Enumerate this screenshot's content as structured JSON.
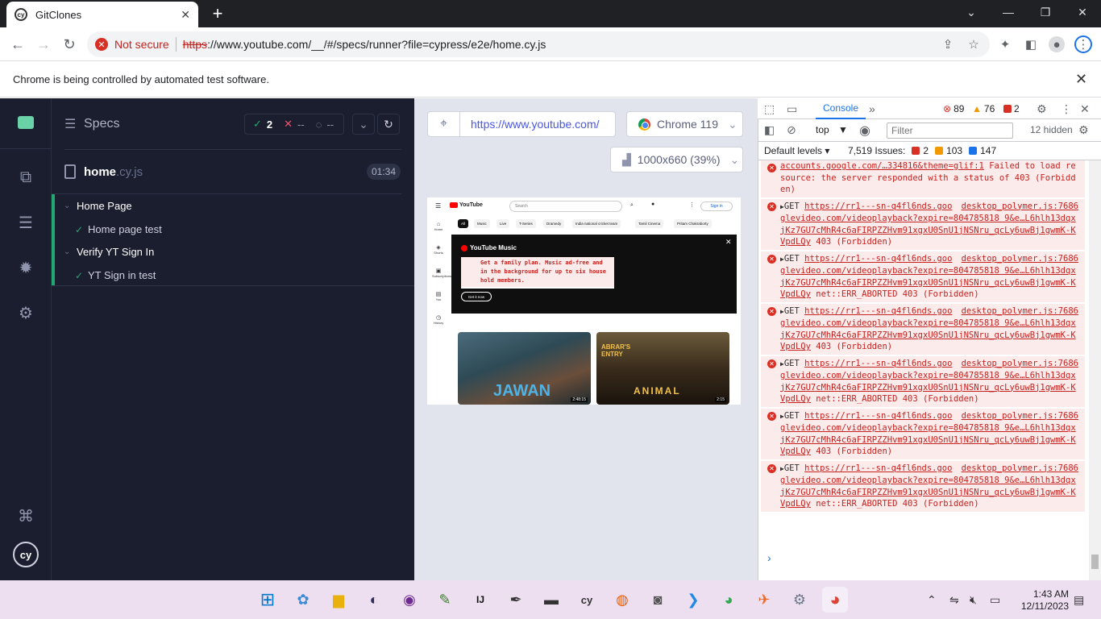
{
  "browser": {
    "tab_title": "GitClones",
    "not_secure_label": "Not secure",
    "url_scheme": "https",
    "url_rest": "://www.youtube.com/__/#/specs/runner?file=cypress/e2e/home.cy.js",
    "infobar_text": "Chrome is being controlled by automated test software."
  },
  "cypress": {
    "specs_title": "Specs",
    "passed_count": "2",
    "failed_count": "--",
    "pending_count": "--",
    "file_name": "home",
    "file_ext": ".cy.js",
    "duration": "01:34",
    "suites": [
      {
        "title": "Home Page",
        "tests": [
          "Home page test"
        ]
      },
      {
        "title": "Verify YT Sign In",
        "tests": [
          "YT Sign in test"
        ]
      }
    ],
    "aut_url": "https://www.youtube.com/",
    "browser_label": "Chrome 119",
    "viewport_label": "1000x660 (39%)"
  },
  "youtube_preview": {
    "logo": "YouTube",
    "search_placeholder": "Search",
    "sign_in": "Sign in",
    "chips": [
      "All",
      "Music",
      "Live",
      "T-Series",
      "Dramedy",
      "India national cricket team",
      "Tamil Cinema",
      "Pritam Chakraborty"
    ],
    "side_items": [
      "Home",
      "Shorts",
      "Subscriptions",
      "You",
      "History"
    ],
    "banner_brand": "YouTube Music",
    "banner_text": "Get a family plan. Music ad-free and in the background for up to six household members.",
    "banner_button": "Get it now",
    "thumb1_title": "JAWAN",
    "thumb1_duration": "2:48:15",
    "thumb2_title": "ANIMAL",
    "thumb2_top": "ABRAR'S ENTRY",
    "thumb2_duration": "2:15"
  },
  "devtools": {
    "tab_console": "Console",
    "errors": "89",
    "warnings": "76",
    "issues_badge": "2",
    "context": "top",
    "filter_placeholder": "Filter",
    "hidden_label": "12 hidden",
    "levels_label": "Default levels",
    "issues_label": "7,519 Issues:",
    "issues_red": "2",
    "issues_orange": "103",
    "issues_blue": "147",
    "messages": [
      {
        "method": "",
        "link": "accounts.google.com/…334816&theme=glif:1",
        "src": "",
        "tail": "Failed to load resource: the server responded with a status of 403 (Forbidden)"
      },
      {
        "method": "GET",
        "link": "https://rr1---sn-q4fl6nds.googlevideo.com/videoplayback?expire=804785818 9&e…L6hlh13dqxjKz7GU7cMhR4c6aFIRPZZHvm91xgxU0SnU1jNSNru_qcLy6uwBj1gwmK-KVpdLQy",
        "src": "desktop_polymer.js:7686",
        "tail": "403 (Forbidden)"
      },
      {
        "method": "GET",
        "link": "https://rr1---sn-q4fl6nds.googlevideo.com/videoplayback?expire=804785818 9&e…L6hlh13dqxjKz7GU7cMhR4c6aFIRPZZHvm91xgxU0SnU1jNSNru_qcLy6uwBj1gwmK-KVpdLQy",
        "src": "desktop_polymer.js:7686",
        "tail": "net::ERR_ABORTED 403 (Forbidden)"
      },
      {
        "method": "GET",
        "link": "https://rr1---sn-q4fl6nds.googlevideo.com/videoplayback?expire=804785818 9&e…L6hlh13dqxjKz7GU7cMhR4c6aFIRPZZHvm91xgxU0SnU1jNSNru_qcLy6uwBj1gwmK-KVpdLQy",
        "src": "desktop_polymer.js:7686",
        "tail": "403 (Forbidden)"
      },
      {
        "method": "GET",
        "link": "https://rr1---sn-q4fl6nds.googlevideo.com/videoplayback?expire=804785818 9&e…L6hlh13dqxjKz7GU7cMhR4c6aFIRPZZHvm91xgxU0SnU1jNSNru_qcLy6uwBj1gwmK-KVpdLQy",
        "src": "desktop_polymer.js:7686",
        "tail": "net::ERR_ABORTED 403 (Forbidden)"
      },
      {
        "method": "GET",
        "link": "https://rr1---sn-q4fl6nds.googlevideo.com/videoplayback?expire=804785818 9&e…L6hlh13dqxjKz7GU7cMhR4c6aFIRPZZHvm91xgxU0SnU1jNSNru_qcLy6uwBj1gwmK-KVpdLQy",
        "src": "desktop_polymer.js:7686",
        "tail": "403 (Forbidden)"
      },
      {
        "method": "GET",
        "link": "https://rr1---sn-q4fl6nds.googlevideo.com/videoplayback?expire=804785818 9&e…L6hlh13dqxjKz7GU7cMhR4c6aFIRPZZHvm91xgxU0SnU1jNSNru_qcLy6uwBj1gwmK-KVpdLQy",
        "src": "desktop_polymer.js:7686",
        "tail": "net::ERR_ABORTED 403 (Forbidden)"
      }
    ]
  },
  "taskbar": {
    "time": "1:43 AM",
    "date": "12/11/2023"
  },
  "colors": {
    "cypress_bg": "#1b1e2e",
    "pass_green": "#1fa971",
    "error_red": "#d93025",
    "console_blue": "#1a73e8"
  }
}
